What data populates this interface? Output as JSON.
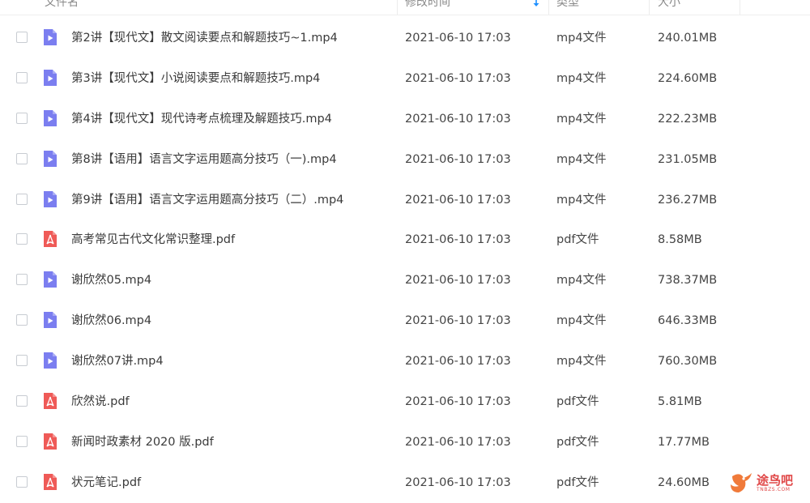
{
  "header": {
    "col_name": "文件名",
    "col_time": "修改时间",
    "col_type": "类型",
    "col_size": "大小"
  },
  "colors": {
    "video_icon": "#7b7ef0",
    "pdf_icon": "#ef5a57",
    "sort_arrow": "#1e90ff",
    "watermark": "#e04848"
  },
  "files": [
    {
      "name": "第2讲【现代文】散文阅读要点和解题技巧~1.mp4",
      "time": "2021-06-10 17:03",
      "type": "mp4文件",
      "size": "240.01MB",
      "icon": "video-file-icon"
    },
    {
      "name": "第3讲【现代文】小说阅读要点和解题技巧.mp4",
      "time": "2021-06-10 17:03",
      "type": "mp4文件",
      "size": "224.60MB",
      "icon": "video-file-icon"
    },
    {
      "name": "第4讲【现代文】现代诗考点梳理及解题技巧.mp4",
      "time": "2021-06-10 17:03",
      "type": "mp4文件",
      "size": "222.23MB",
      "icon": "video-file-icon"
    },
    {
      "name": "第8讲【语用】语言文字运用题高分技巧（一).mp4",
      "time": "2021-06-10 17:03",
      "type": "mp4文件",
      "size": "231.05MB",
      "icon": "video-file-icon"
    },
    {
      "name": "第9讲【语用】语言文字运用题高分技巧（二）.mp4",
      "time": "2021-06-10 17:03",
      "type": "mp4文件",
      "size": "236.27MB",
      "icon": "video-file-icon"
    },
    {
      "name": "高考常见古代文化常识整理.pdf",
      "time": "2021-06-10 17:03",
      "type": "pdf文件",
      "size": "8.58MB",
      "icon": "pdf-file-icon"
    },
    {
      "name": "谢欣然05.mp4",
      "time": "2021-06-10 17:03",
      "type": "mp4文件",
      "size": "738.37MB",
      "icon": "video-file-icon"
    },
    {
      "name": "谢欣然06.mp4",
      "time": "2021-06-10 17:03",
      "type": "mp4文件",
      "size": "646.33MB",
      "icon": "video-file-icon"
    },
    {
      "name": "谢欣然07讲.mp4",
      "time": "2021-06-10 17:03",
      "type": "mp4文件",
      "size": "760.30MB",
      "icon": "video-file-icon"
    },
    {
      "name": "欣然说.pdf",
      "time": "2021-06-10 17:03",
      "type": "pdf文件",
      "size": "5.81MB",
      "icon": "pdf-file-icon"
    },
    {
      "name": "新闻时政素材 2020 版.pdf",
      "time": "2021-06-10 17:03",
      "type": "pdf文件",
      "size": "17.77MB",
      "icon": "pdf-file-icon"
    },
    {
      "name": "状元笔记.pdf",
      "time": "2021-06-10 17:03",
      "type": "pdf文件",
      "size": "24.60MB",
      "icon": "pdf-file-icon"
    }
  ],
  "watermark": {
    "text": "途鸟吧",
    "sub": "TNBZS.COM"
  }
}
